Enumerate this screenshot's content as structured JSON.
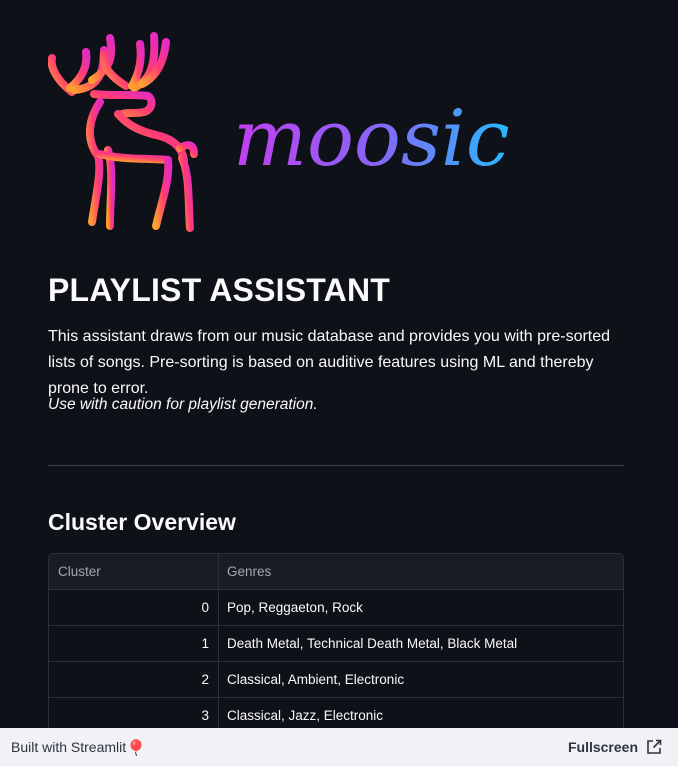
{
  "logo": {
    "wordmark": "moosic",
    "icon": "moose-logo-icon"
  },
  "header": {
    "title": "PLAYLIST ASSISTANT",
    "intro": "This assistant draws from our music database and provides you with pre-sorted lists of songs. Pre-sorting is based on auditive features using ML and thereby prone to error.",
    "caution": "Use with caution for playlist generation."
  },
  "overview": {
    "title": "Cluster Overview",
    "columns": [
      "Cluster",
      "Genres"
    ],
    "rows": [
      {
        "cluster": "0",
        "genres": "Pop, Reggaeton, Rock"
      },
      {
        "cluster": "1",
        "genres": "Death Metal, Technical Death Metal, Black Metal"
      },
      {
        "cluster": "2",
        "genres": "Classical, Ambient, Electronic"
      },
      {
        "cluster": "3",
        "genres": "Classical, Jazz, Electronic"
      }
    ]
  },
  "footer": {
    "built_with": "Built with Streamlit",
    "built_icon": "balloon-icon",
    "fullscreen": "Fullscreen",
    "fullscreen_icon": "external-link-icon"
  },
  "colors": {
    "background": "#0e1117",
    "footer_bg": "#f0f2f6",
    "gradient_orange": "#ff9f2f",
    "gradient_pink": "#ff2d8a",
    "gradient_purple": "#b043f0",
    "gradient_blue": "#2ab8ff"
  }
}
